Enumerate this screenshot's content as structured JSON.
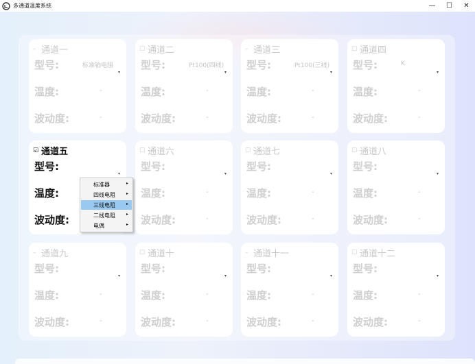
{
  "window": {
    "title": "多通道温度系统"
  },
  "cards": [
    {
      "id": 1,
      "name": "通道一",
      "model_label": "型号:",
      "model_value": "标准铂电阻",
      "temp_label": "温度:",
      "temp_value": "-",
      "fluct_label": "波动度:",
      "fluct_value": "-",
      "checked": false,
      "active": false
    },
    {
      "id": 2,
      "name": "通道二",
      "model_label": "型号:",
      "model_value": "Pt100(四线)",
      "temp_label": "温度:",
      "temp_value": "-",
      "fluct_label": "波动度:",
      "fluct_value": "-",
      "checked": false,
      "active": false
    },
    {
      "id": 3,
      "name": "通道三",
      "model_label": "型号:",
      "model_value": "Pt100(三线)",
      "temp_label": "温度:",
      "temp_value": "-",
      "fluct_label": "波动度:",
      "fluct_value": "-",
      "checked": false,
      "active": false
    },
    {
      "id": 4,
      "name": "通道四",
      "model_label": "型号:",
      "model_value": "K",
      "temp_label": "温度:",
      "temp_value": "-",
      "fluct_label": "波动度:",
      "fluct_value": "-",
      "checked": false,
      "active": false
    },
    {
      "id": 5,
      "name": "通道五",
      "model_label": "型号:",
      "model_value": "",
      "temp_label": "温度:",
      "temp_value": "",
      "fluct_label": "波动度:",
      "fluct_value": "",
      "checked": true,
      "active": true
    },
    {
      "id": 6,
      "name": "通道六",
      "model_label": "型号:",
      "model_value": "",
      "temp_label": "温度:",
      "temp_value": "-",
      "fluct_label": "波动度:",
      "fluct_value": "-",
      "checked": false,
      "active": false
    },
    {
      "id": 7,
      "name": "通道七",
      "model_label": "型号:",
      "model_value": "",
      "temp_label": "温度:",
      "temp_value": "-",
      "fluct_label": "波动度:",
      "fluct_value": "-",
      "checked": false,
      "active": false
    },
    {
      "id": 8,
      "name": "通道八",
      "model_label": "型号:",
      "model_value": "",
      "temp_label": "温度:",
      "temp_value": "-",
      "fluct_label": "波动度:",
      "fluct_value": "-",
      "checked": false,
      "active": false
    },
    {
      "id": 9,
      "name": "通道九",
      "model_label": "型号:",
      "model_value": "",
      "temp_label": "温度:",
      "temp_value": "-",
      "fluct_label": "波动度:",
      "fluct_value": "-",
      "checked": false,
      "active": false
    },
    {
      "id": 10,
      "name": "通道十",
      "model_label": "型号:",
      "model_value": "",
      "temp_label": "温度:",
      "temp_value": "-",
      "fluct_label": "波动度:",
      "fluct_value": "-",
      "checked": false,
      "active": false
    },
    {
      "id": 11,
      "name": "通道十一",
      "model_label": "型号:",
      "model_value": "",
      "temp_label": "温度:",
      "temp_value": "-",
      "fluct_label": "波动度:",
      "fluct_value": "-",
      "checked": false,
      "active": false
    },
    {
      "id": 12,
      "name": "通道十二",
      "model_label": "型号:",
      "model_value": "",
      "temp_label": "温度:",
      "temp_value": "-",
      "fluct_label": "波动度:",
      "fluct_value": "-",
      "checked": false,
      "active": false
    }
  ],
  "context_menu": {
    "items": [
      {
        "label": "标准器",
        "highlighted": false
      },
      {
        "label": "四线电阻",
        "highlighted": false
      },
      {
        "label": "三线电阻",
        "highlighted": true
      },
      {
        "label": "二线电阻",
        "highlighted": false
      },
      {
        "label": "电偶",
        "highlighted": false
      }
    ],
    "submenu_arrow": "▸"
  },
  "glyphs": {
    "minimize": "—",
    "maximize": "☐",
    "close": "✕",
    "dropdown_caret": "▾",
    "checkbox_unchecked": "☐",
    "checkbox_checked": "☑",
    "checkbox_dash": "–"
  },
  "colors": {
    "menu_highlight": "#99c9f0",
    "inactive_text": "#cfcfcf"
  }
}
